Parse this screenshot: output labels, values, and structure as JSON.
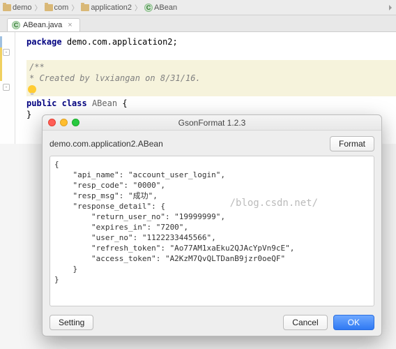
{
  "breadcrumb": {
    "items": [
      {
        "icon": "folder",
        "label": "demo"
      },
      {
        "icon": "folder",
        "label": "com"
      },
      {
        "icon": "folder",
        "label": "application2"
      },
      {
        "icon": "class",
        "label": "ABean"
      }
    ]
  },
  "tab": {
    "icon_letter": "C",
    "filename": "ABean.java"
  },
  "editor": {
    "package_kw": "package",
    "package_path": "demo.com.application2;",
    "doc_open": "/**",
    "doc_line": " * Created by lvxiangan on 8/31/16.",
    "public_kw": "public",
    "class_kw": "class",
    "class_name": "ABean",
    "brace_open": "{",
    "brace_close": "}"
  },
  "dialog": {
    "title": "GsonFormat 1.2.3",
    "class_path": "demo.com.application2.ABean",
    "format_btn": "Format",
    "json_text": "{\n    \"api_name\": \"account_user_login\",\n    \"resp_code\": \"0000\",\n    \"resp_msg\": \"成功\",\n    \"response_detail\": {\n        \"return_user_no\": \"19999999\",\n        \"expires_in\": \"7200\",\n        \"user_no\": \"1122233445566\",\n        \"refresh_token\": \"Ao77AM1xaEku2QJAcYpVn9cE\",\n        \"access_token\": \"A2KzM7QvQLTDanB9jzr0oeQF\"\n    }\n}",
    "watermark": "/blog.csdn.net/",
    "setting_btn": "Setting",
    "cancel_btn": "Cancel",
    "ok_btn": "OK"
  }
}
